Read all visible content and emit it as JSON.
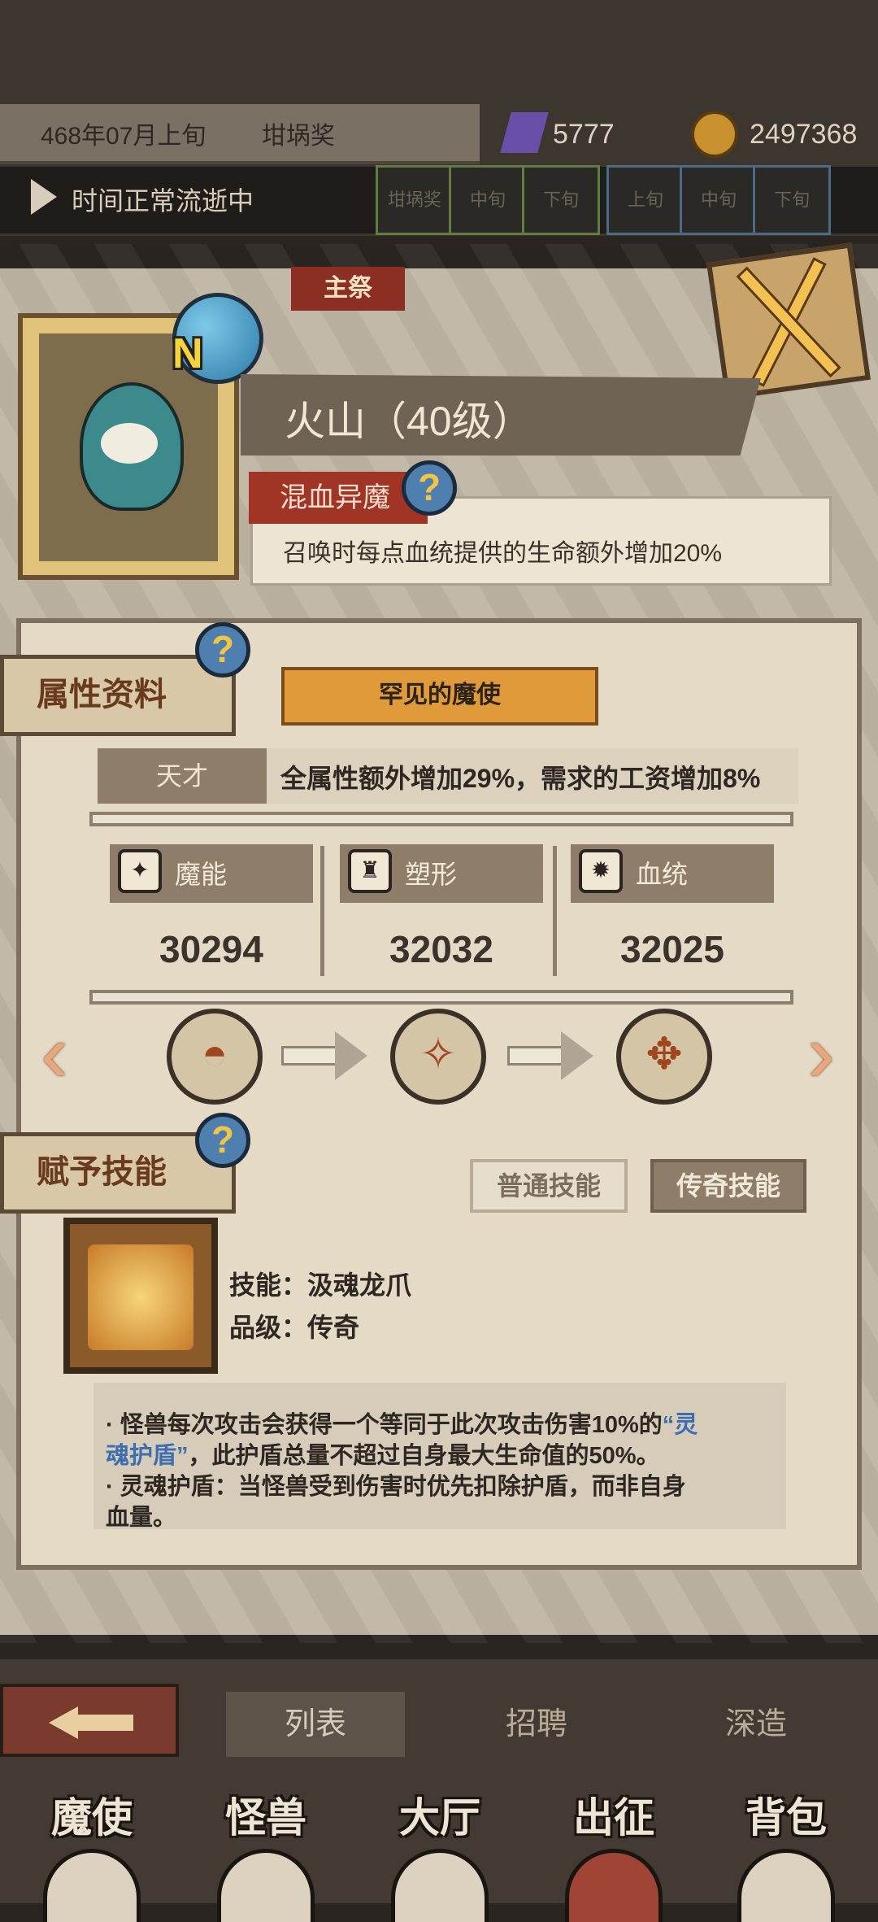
{
  "header": {
    "date": "468年07月上旬",
    "event": "坩埚奖",
    "crystals": "5777",
    "gold": "2497368",
    "status": "时间正常流逝中",
    "slots": [
      "坩埚奖",
      "中旬",
      "下旬",
      "上旬",
      "中旬",
      "下旬"
    ]
  },
  "tab": "主祭",
  "monster": {
    "rank": "N",
    "name": "火山（40级）",
    "trait_name": "混血异魔",
    "trait_desc": "召唤时每点血统提供的生命额外增加20%"
  },
  "attributes": {
    "section_label": "属性资料",
    "rarity": "罕见的魔使",
    "talent_tag": "天才",
    "talent_desc": "全属性额外增加29%，需求的工资增加8%",
    "stats": [
      {
        "name": "魔能",
        "value": "30294",
        "icon": "magic-icon"
      },
      {
        "name": "塑形",
        "value": "32032",
        "icon": "shape-icon"
      },
      {
        "name": "血统",
        "value": "32025",
        "icon": "bloodline-icon"
      }
    ]
  },
  "skills": {
    "section_label": "赋予技能",
    "tab_normal": "普通技能",
    "tab_legend": "传奇技能",
    "skill_name_line": "技能：汲魂龙爪",
    "skill_grade_line": "品级：传奇",
    "desc_bullet1_a": "·   怪兽每次攻击会获得一个等同于此次攻击伤害10%的",
    "desc_bullet1_hl1": "“灵",
    "desc_bullet1_hl2": "魂护盾”",
    "desc_bullet1_b": "，此护盾总量不超过自身最大生命值的50%。",
    "desc_bullet2_a": "·   灵魂护盾：当怪兽受到伤害时优先扣除护盾，而非自身",
    "desc_bullet2_b": "血量。"
  },
  "subnav": {
    "list": "列表",
    "recruit": "招聘",
    "forge": "深造"
  },
  "mainnav": [
    "魔使",
    "怪兽",
    "大厅",
    "出征",
    "背包"
  ]
}
